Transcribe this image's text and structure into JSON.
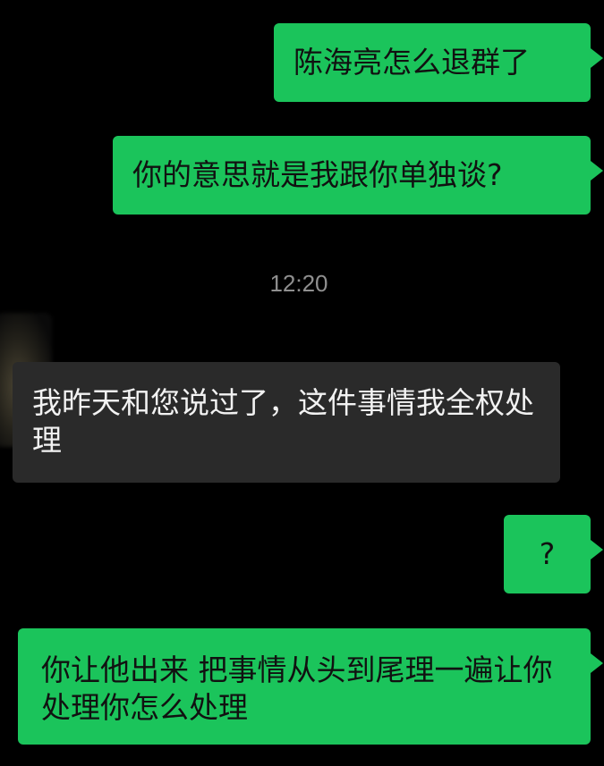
{
  "messages": [
    {
      "direction": "out",
      "text": "陈海亮怎么退群了"
    },
    {
      "direction": "out",
      "text": "你的意思就是我跟你单独谈?"
    },
    {
      "direction": "timestamp",
      "text": "12:20"
    },
    {
      "direction": "in",
      "text": "我昨天和您说过了，这件事情我全权处理"
    },
    {
      "direction": "out",
      "text": "?"
    },
    {
      "direction": "out",
      "text": "你让他出来 把事情从头到尾理一遍让你处理你怎么处理"
    }
  ],
  "colors": {
    "background": "#000000",
    "outgoing_bubble": "#1bc45b",
    "incoming_bubble": "#2a2a2a",
    "timestamp_text": "#8f8f8f"
  }
}
